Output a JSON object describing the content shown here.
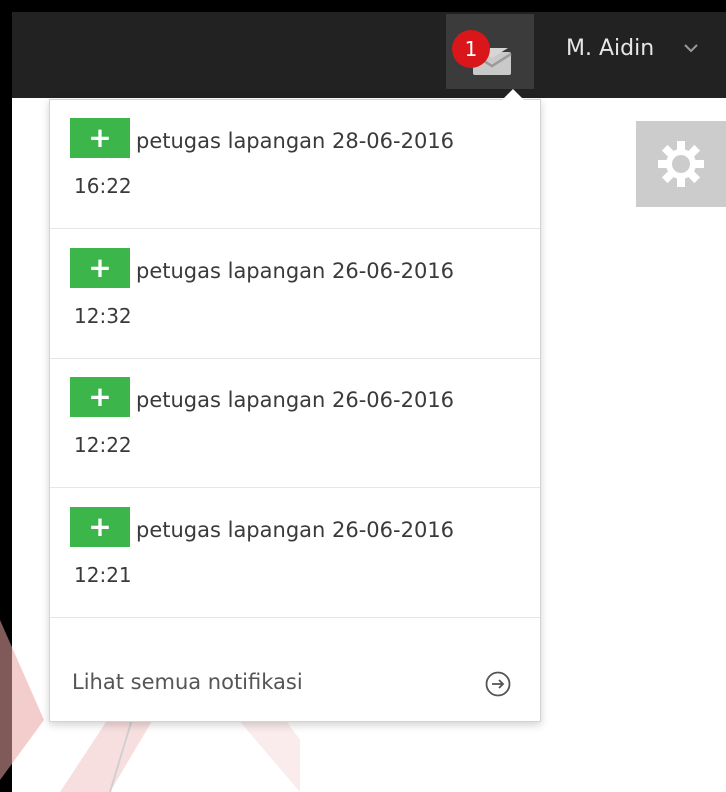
{
  "header": {
    "notification_count": "1",
    "user_name": "M. Aidin"
  },
  "notifications": [
    {
      "title": "petugas lapangan 28-06-2016",
      "time": "16:22",
      "icon": "plus-icon"
    },
    {
      "title": "petugas lapangan 26-06-2016",
      "time": "12:32",
      "icon": "plus-icon"
    },
    {
      "title": "petugas lapangan 26-06-2016",
      "time": "12:22",
      "icon": "plus-icon"
    },
    {
      "title": "petugas lapangan 26-06-2016",
      "time": "12:21",
      "icon": "plus-icon"
    }
  ],
  "footer": {
    "see_all_label": "Lihat semua notifikasi",
    "icon": "arrow-circle-right-icon"
  },
  "colors": {
    "topbar": "#222222",
    "badge": "#d9171b",
    "plus_box": "#3cb54a",
    "gear_tile": "#cccccc"
  },
  "icons": {
    "mail": "mail-icon",
    "chevron": "chevron-down-icon",
    "gear": "gear-icon"
  }
}
